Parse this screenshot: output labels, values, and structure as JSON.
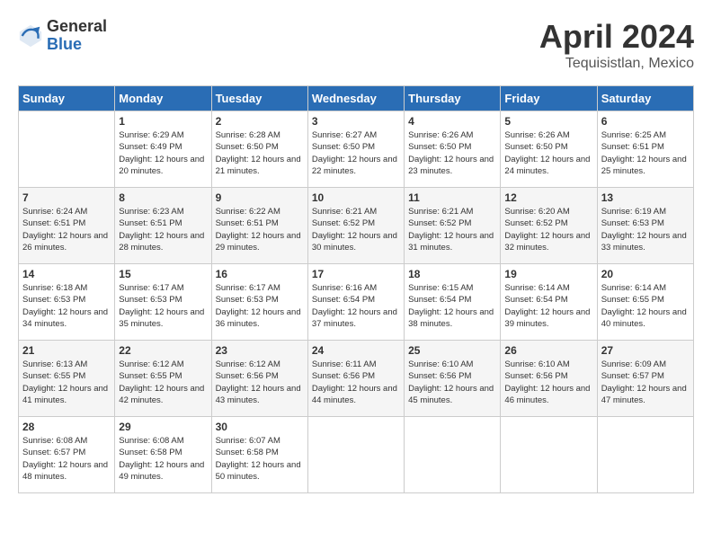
{
  "header": {
    "logo_general": "General",
    "logo_blue": "Blue",
    "month_year": "April 2024",
    "location": "Tequisistlan, Mexico"
  },
  "days_of_week": [
    "Sunday",
    "Monday",
    "Tuesday",
    "Wednesday",
    "Thursday",
    "Friday",
    "Saturday"
  ],
  "weeks": [
    [
      {
        "day": "",
        "sunrise": "",
        "sunset": "",
        "daylight": ""
      },
      {
        "day": "1",
        "sunrise": "Sunrise: 6:29 AM",
        "sunset": "Sunset: 6:49 PM",
        "daylight": "Daylight: 12 hours and 20 minutes."
      },
      {
        "day": "2",
        "sunrise": "Sunrise: 6:28 AM",
        "sunset": "Sunset: 6:50 PM",
        "daylight": "Daylight: 12 hours and 21 minutes."
      },
      {
        "day": "3",
        "sunrise": "Sunrise: 6:27 AM",
        "sunset": "Sunset: 6:50 PM",
        "daylight": "Daylight: 12 hours and 22 minutes."
      },
      {
        "day": "4",
        "sunrise": "Sunrise: 6:26 AM",
        "sunset": "Sunset: 6:50 PM",
        "daylight": "Daylight: 12 hours and 23 minutes."
      },
      {
        "day": "5",
        "sunrise": "Sunrise: 6:26 AM",
        "sunset": "Sunset: 6:50 PM",
        "daylight": "Daylight: 12 hours and 24 minutes."
      },
      {
        "day": "6",
        "sunrise": "Sunrise: 6:25 AM",
        "sunset": "Sunset: 6:51 PM",
        "daylight": "Daylight: 12 hours and 25 minutes."
      }
    ],
    [
      {
        "day": "7",
        "sunrise": "Sunrise: 6:24 AM",
        "sunset": "Sunset: 6:51 PM",
        "daylight": "Daylight: 12 hours and 26 minutes."
      },
      {
        "day": "8",
        "sunrise": "Sunrise: 6:23 AM",
        "sunset": "Sunset: 6:51 PM",
        "daylight": "Daylight: 12 hours and 28 minutes."
      },
      {
        "day": "9",
        "sunrise": "Sunrise: 6:22 AM",
        "sunset": "Sunset: 6:51 PM",
        "daylight": "Daylight: 12 hours and 29 minutes."
      },
      {
        "day": "10",
        "sunrise": "Sunrise: 6:21 AM",
        "sunset": "Sunset: 6:52 PM",
        "daylight": "Daylight: 12 hours and 30 minutes."
      },
      {
        "day": "11",
        "sunrise": "Sunrise: 6:21 AM",
        "sunset": "Sunset: 6:52 PM",
        "daylight": "Daylight: 12 hours and 31 minutes."
      },
      {
        "day": "12",
        "sunrise": "Sunrise: 6:20 AM",
        "sunset": "Sunset: 6:52 PM",
        "daylight": "Daylight: 12 hours and 32 minutes."
      },
      {
        "day": "13",
        "sunrise": "Sunrise: 6:19 AM",
        "sunset": "Sunset: 6:53 PM",
        "daylight": "Daylight: 12 hours and 33 minutes."
      }
    ],
    [
      {
        "day": "14",
        "sunrise": "Sunrise: 6:18 AM",
        "sunset": "Sunset: 6:53 PM",
        "daylight": "Daylight: 12 hours and 34 minutes."
      },
      {
        "day": "15",
        "sunrise": "Sunrise: 6:17 AM",
        "sunset": "Sunset: 6:53 PM",
        "daylight": "Daylight: 12 hours and 35 minutes."
      },
      {
        "day": "16",
        "sunrise": "Sunrise: 6:17 AM",
        "sunset": "Sunset: 6:53 PM",
        "daylight": "Daylight: 12 hours and 36 minutes."
      },
      {
        "day": "17",
        "sunrise": "Sunrise: 6:16 AM",
        "sunset": "Sunset: 6:54 PM",
        "daylight": "Daylight: 12 hours and 37 minutes."
      },
      {
        "day": "18",
        "sunrise": "Sunrise: 6:15 AM",
        "sunset": "Sunset: 6:54 PM",
        "daylight": "Daylight: 12 hours and 38 minutes."
      },
      {
        "day": "19",
        "sunrise": "Sunrise: 6:14 AM",
        "sunset": "Sunset: 6:54 PM",
        "daylight": "Daylight: 12 hours and 39 minutes."
      },
      {
        "day": "20",
        "sunrise": "Sunrise: 6:14 AM",
        "sunset": "Sunset: 6:55 PM",
        "daylight": "Daylight: 12 hours and 40 minutes."
      }
    ],
    [
      {
        "day": "21",
        "sunrise": "Sunrise: 6:13 AM",
        "sunset": "Sunset: 6:55 PM",
        "daylight": "Daylight: 12 hours and 41 minutes."
      },
      {
        "day": "22",
        "sunrise": "Sunrise: 6:12 AM",
        "sunset": "Sunset: 6:55 PM",
        "daylight": "Daylight: 12 hours and 42 minutes."
      },
      {
        "day": "23",
        "sunrise": "Sunrise: 6:12 AM",
        "sunset": "Sunset: 6:56 PM",
        "daylight": "Daylight: 12 hours and 43 minutes."
      },
      {
        "day": "24",
        "sunrise": "Sunrise: 6:11 AM",
        "sunset": "Sunset: 6:56 PM",
        "daylight": "Daylight: 12 hours and 44 minutes."
      },
      {
        "day": "25",
        "sunrise": "Sunrise: 6:10 AM",
        "sunset": "Sunset: 6:56 PM",
        "daylight": "Daylight: 12 hours and 45 minutes."
      },
      {
        "day": "26",
        "sunrise": "Sunrise: 6:10 AM",
        "sunset": "Sunset: 6:56 PM",
        "daylight": "Daylight: 12 hours and 46 minutes."
      },
      {
        "day": "27",
        "sunrise": "Sunrise: 6:09 AM",
        "sunset": "Sunset: 6:57 PM",
        "daylight": "Daylight: 12 hours and 47 minutes."
      }
    ],
    [
      {
        "day": "28",
        "sunrise": "Sunrise: 6:08 AM",
        "sunset": "Sunset: 6:57 PM",
        "daylight": "Daylight: 12 hours and 48 minutes."
      },
      {
        "day": "29",
        "sunrise": "Sunrise: 6:08 AM",
        "sunset": "Sunset: 6:58 PM",
        "daylight": "Daylight: 12 hours and 49 minutes."
      },
      {
        "day": "30",
        "sunrise": "Sunrise: 6:07 AM",
        "sunset": "Sunset: 6:58 PM",
        "daylight": "Daylight: 12 hours and 50 minutes."
      },
      {
        "day": "",
        "sunrise": "",
        "sunset": "",
        "daylight": ""
      },
      {
        "day": "",
        "sunrise": "",
        "sunset": "",
        "daylight": ""
      },
      {
        "day": "",
        "sunrise": "",
        "sunset": "",
        "daylight": ""
      },
      {
        "day": "",
        "sunrise": "",
        "sunset": "",
        "daylight": ""
      }
    ]
  ]
}
